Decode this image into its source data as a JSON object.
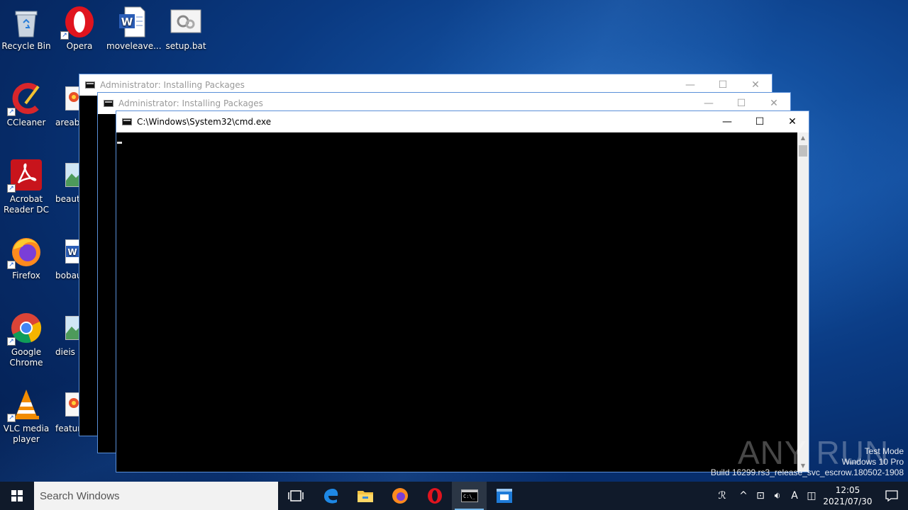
{
  "desktop": {
    "icons": [
      {
        "label": "Recycle Bin"
      },
      {
        "label": "Opera"
      },
      {
        "label": "moveleave..."
      },
      {
        "label": "setup.bat"
      },
      {
        "label": "CCleaner"
      },
      {
        "label": "Acrobat Reader DC"
      },
      {
        "label": "Firefox"
      },
      {
        "label": "Google Chrome"
      },
      {
        "label": "VLC media player"
      }
    ],
    "partial_icons": [
      {
        "label": "areabu"
      },
      {
        "label": "beauti"
      },
      {
        "label": "bobau"
      },
      {
        "label": "dieis"
      },
      {
        "label": "featur"
      }
    ]
  },
  "windows": {
    "back": {
      "title": "Administrator:  Installing Packages"
    },
    "middle": {
      "title": "Administrator:  Installing Packages"
    },
    "front": {
      "title": "C:\\Windows\\System32\\cmd.exe"
    }
  },
  "watermark": {
    "line1": "Test Mode",
    "line2": "Windows 10 Pro",
    "line3": "Build 16299.rs3_release_svc_escrow.180502-1908",
    "brand": "ANY RUN"
  },
  "taskbar": {
    "search_placeholder": "Search Windows",
    "clock_time": "12:05",
    "clock_date": "2021/07/30",
    "input_indicator": "A"
  },
  "colors": {
    "accent": "#76b9ed",
    "desktop": "#0a3a82",
    "taskbar": "#101a2a"
  }
}
